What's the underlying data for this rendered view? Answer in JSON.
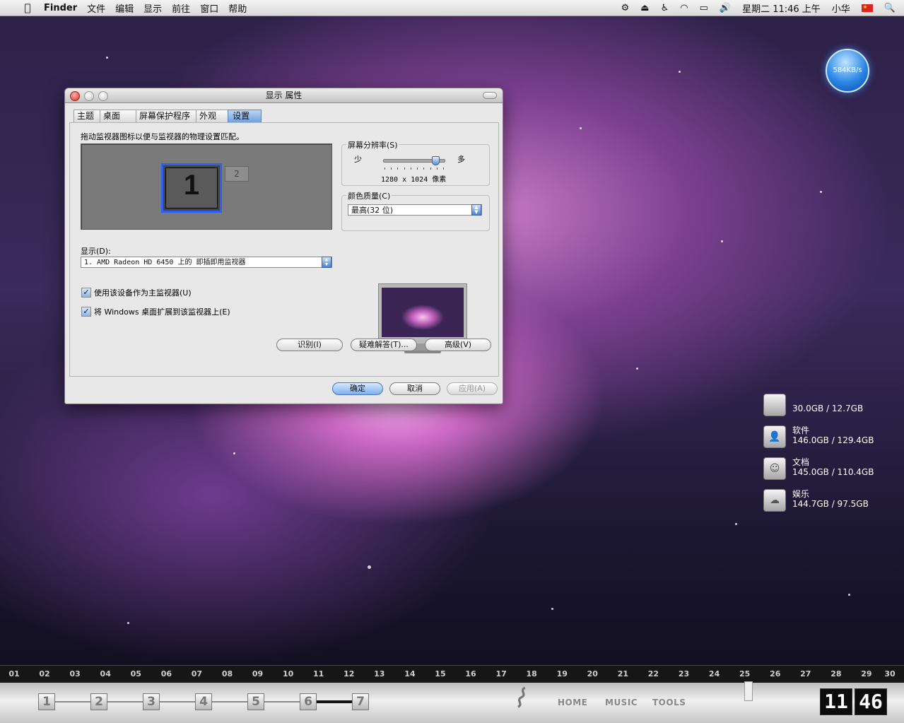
{
  "menubar": {
    "app": "Finder",
    "items": [
      "文件",
      "编辑",
      "显示",
      "前往",
      "窗口",
      "帮助"
    ],
    "clock": "星期二 11:46 上午",
    "user": "小华"
  },
  "window": {
    "title": "显示 属性",
    "tabs": [
      "主题",
      "桌面",
      "屏幕保护程序",
      "外观",
      "设置"
    ],
    "active_tab": "设置",
    "instruction": "拖动监视器图标以便与监视器的物理设置匹配。",
    "monitor1": "1",
    "monitor2": "2",
    "resolution": {
      "group_title": "屏幕分辨率(S)",
      "less": "少",
      "more": "多",
      "value_text": "1280 x 1024 像素",
      "slider_position": 0.85
    },
    "color_quality": {
      "group_title": "颜色质量(C)",
      "value": "最高(32 位)"
    },
    "display": {
      "label": "显示(D):",
      "value": "1. AMD Radeon HD 6450 上的 即插即用监视器"
    },
    "checkboxes": [
      {
        "label": "使用该设备作为主监视器(U)",
        "checked": true
      },
      {
        "label": "将 Windows 桌面扩展到该监视器上(E)",
        "checked": true
      }
    ],
    "buttons": {
      "identify": "识别(I)",
      "troubleshoot": "疑难解答(T)...",
      "advanced": "高级(V)",
      "ok": "确定",
      "cancel": "取消",
      "apply": "应用(A)"
    }
  },
  "widgets": {
    "net_speed": "584KB/s",
    "drives": [
      {
        "name": "",
        "size": "30.0GB / 12.7GB",
        "icon": "apple-drive-icon"
      },
      {
        "name": "软件",
        "size": "146.0GB / 129.4GB",
        "icon": "user-drive-icon"
      },
      {
        "name": "文档",
        "size": "145.0GB / 110.4GB",
        "icon": "document-drive-icon"
      },
      {
        "name": "娱乐",
        "size": "144.7GB / 97.5GB",
        "icon": "cloud-drive-icon"
      }
    ]
  },
  "timeline": [
    "01",
    "02",
    "03",
    "04",
    "05",
    "06",
    "07",
    "08",
    "09",
    "10",
    "11",
    "12",
    "13",
    "14",
    "15",
    "16",
    "17",
    "18",
    "19",
    "20",
    "21",
    "22",
    "23",
    "24",
    "25",
    "26",
    "27",
    "28",
    "29",
    "30"
  ],
  "dock": {
    "workspaces": [
      "1",
      "2",
      "3",
      "4",
      "5",
      "6",
      "7"
    ],
    "links": [
      "HOME",
      "MUSIC",
      "TOOLS"
    ],
    "clock_hour": "11",
    "clock_minute": "46"
  }
}
